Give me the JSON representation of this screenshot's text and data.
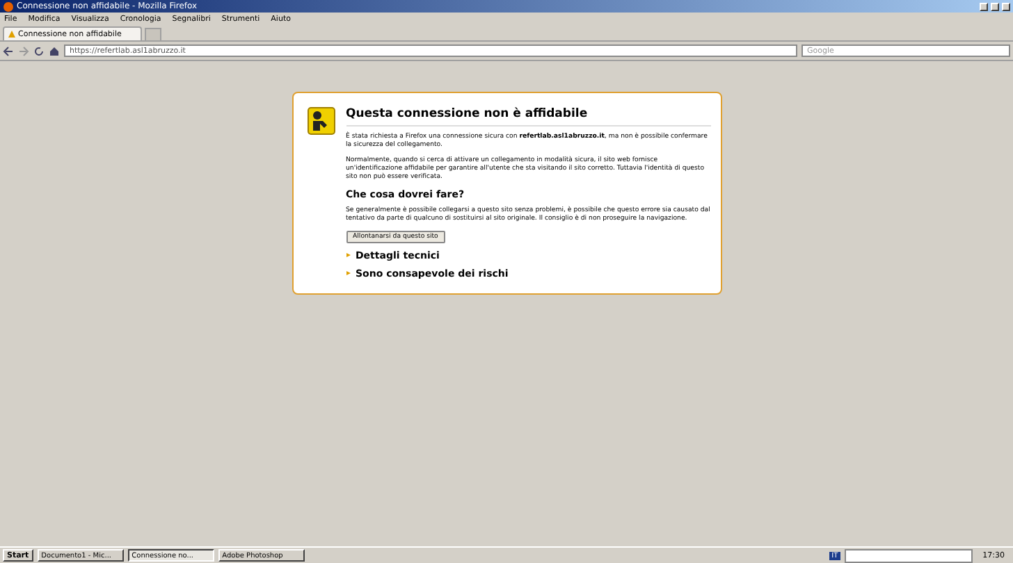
{
  "window": {
    "title": "Connessione non affidabile - Mozilla Firefox"
  },
  "menu": [
    "File",
    "Modifica",
    "Visualizza",
    "Cronologia",
    "Segnalibri",
    "Strumenti",
    "Aiuto"
  ],
  "tabs": [
    {
      "label": "Connessione non affidabile",
      "selected": true
    }
  ],
  "address": {
    "value": "https://refertlab.asl1abruzzo.it"
  },
  "search": {
    "placeholder": "Google"
  },
  "error": {
    "title": "Questa connessione non è affidabile",
    "paragraphs": [
      "È stata richiesta a Firefox una connessione sicura con **refertlab.asl1abruzzo.it**, ma non è possibile confermare la sicurezza del collegamento.",
      "Normalmente, quando si cerca di attivare un collegamento in modalità sicura, il sito web fornisce un'identificazione affidabile per garantire all'utente che sta visitando il sito corretto. Tuttavia l'identità di questo sito non può essere verificata."
    ],
    "question": "Che cosa dovrei fare?",
    "advice": "Se generalmente è possibile collegarsi a questo sito senza problemi, è possibile che questo errore sia causato dal tentativo da parte di qualcuno di sostituirsi al sito originale. Il consiglio è di non proseguire la navigazione.",
    "button": "Allontanarsi da questo sito",
    "sections": [
      {
        "label": "Dettagli tecnici",
        "expanded": false
      },
      {
        "label": "Sono consapevole dei rischi",
        "expanded": false
      }
    ]
  },
  "taskbar": {
    "start": "Start",
    "items": [
      {
        "label": "Documento1 - Mic...",
        "selected": false
      },
      {
        "label": "Connessione no...",
        "selected": true
      },
      {
        "label": "Adobe Photoshop",
        "selected": false
      }
    ],
    "language": "IT",
    "clock": "17:30"
  }
}
